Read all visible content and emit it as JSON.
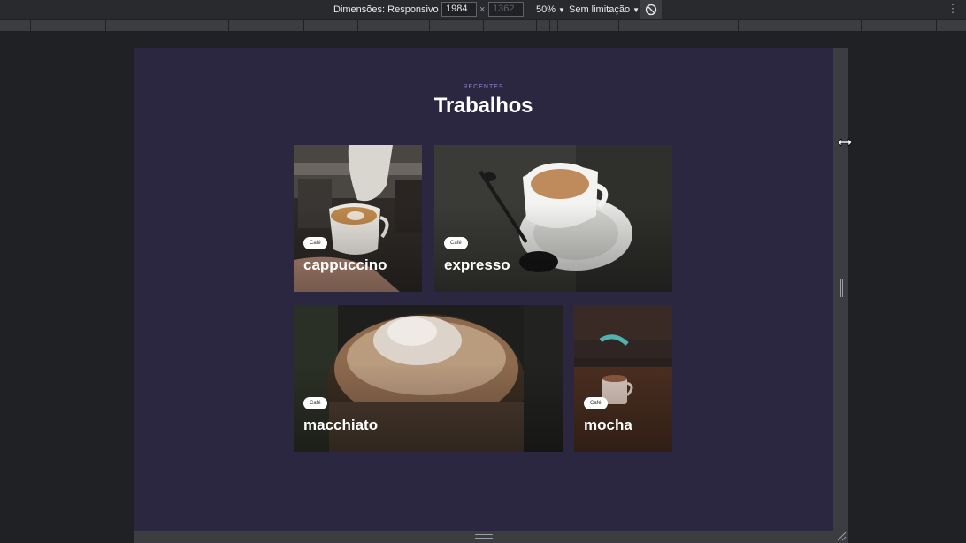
{
  "devtools": {
    "dimensions_label": "Dimensões: Responsivo",
    "width_value": "1984",
    "times_sign": "×",
    "height_value": "1362",
    "zoom_label": "50%",
    "throttle_label": "Sem limitação",
    "caret": "▼",
    "more_icon": "⋮"
  },
  "page": {
    "kicker": "RECENTES",
    "title": "Trabalhos",
    "cards": [
      {
        "tag": "Café",
        "title": "cappuccino"
      },
      {
        "tag": "Café",
        "title": "expresso"
      },
      {
        "tag": "Café",
        "title": "macchiato"
      },
      {
        "tag": "Café",
        "title": "mocha"
      }
    ]
  },
  "colors": {
    "viewport_bg": "#2c2740",
    "kicker": "#8f80d8",
    "devtools_bg": "#202124"
  }
}
